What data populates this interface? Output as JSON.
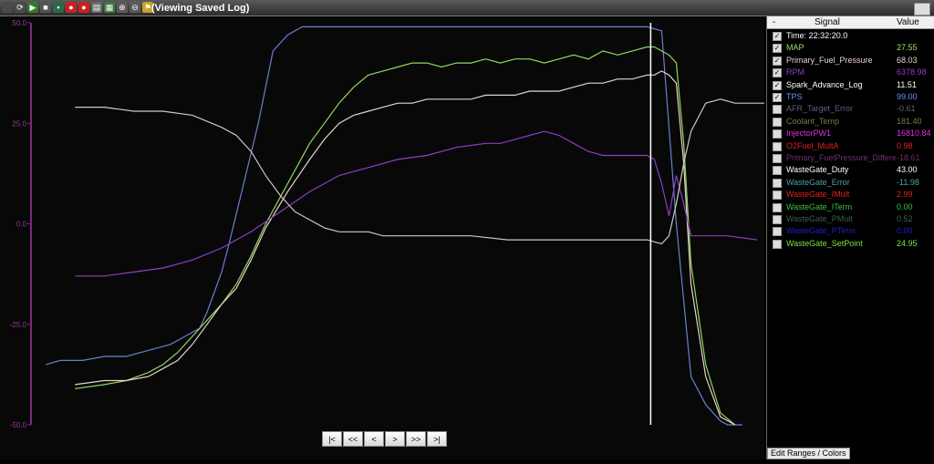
{
  "window": {
    "title": "(Viewing Saved Log)"
  },
  "toolbar": {
    "icons": [
      {
        "name": "open-icon",
        "color": "#4a4a4a",
        "glyph": ""
      },
      {
        "name": "refresh-icon",
        "color": "#4a4a4a",
        "glyph": "⟳"
      },
      {
        "name": "play-icon",
        "color": "#2d7d2d",
        "glyph": "▶"
      },
      {
        "name": "stop-icon",
        "color": "#555555",
        "glyph": "■"
      },
      {
        "name": "save-icon",
        "color": "#2a6a4a",
        "glyph": "▪"
      },
      {
        "name": "record-icon",
        "color": "#cc2020",
        "glyph": "●"
      },
      {
        "name": "record-stop-icon",
        "color": "#cc2020",
        "glyph": "●"
      },
      {
        "name": "print-icon",
        "color": "#6a6a6a",
        "glyph": "▤"
      },
      {
        "name": "export-icon",
        "color": "#3a7a3a",
        "glyph": "▦"
      },
      {
        "name": "zoom-in-icon",
        "color": "#5a5a5a",
        "glyph": "⊕"
      },
      {
        "name": "zoom-out-icon",
        "color": "#5a5a5a",
        "glyph": "⊖"
      },
      {
        "name": "marker-icon",
        "color": "#caa020",
        "glyph": "⚑"
      }
    ]
  },
  "panel": {
    "header": {
      "minus": "-",
      "signal": "Signal",
      "value": "Value"
    },
    "signals": [
      {
        "name": "Time: 22:32:20.0",
        "value": "",
        "color": "#ffffff",
        "checked": true
      },
      {
        "name": "MAP",
        "value": "27.55",
        "color": "#9ae06a",
        "checked": true
      },
      {
        "name": "Primary_Fuel_Pressure",
        "value": "68.03",
        "color": "#e8d4c8",
        "checked": true
      },
      {
        "name": "RPM",
        "value": "6378.98",
        "color": "#9040c0",
        "checked": true
      },
      {
        "name": "Spark_Advance_Log",
        "value": "11.51",
        "color": "#ffffff",
        "checked": true
      },
      {
        "name": "TPS",
        "value": "99.00",
        "color": "#7090ff",
        "checked": true
      },
      {
        "name": "AFR_Target_Error",
        "value": "-0.61",
        "color": "#606080",
        "checked": false
      },
      {
        "name": "Coolant_Temp",
        "value": "181.40",
        "color": "#807a40",
        "checked": false
      },
      {
        "name": "InjectorPW1",
        "value": "16810.84",
        "color": "#e030e0",
        "checked": false
      },
      {
        "name": "O2Fuel_MultA",
        "value": "0.98",
        "color": "#e02020",
        "checked": false
      },
      {
        "name": "Primary_FuelPressure_Difference",
        "value": "-18.61",
        "color": "#703070",
        "checked": false
      },
      {
        "name": "WasteGate_Duty",
        "value": "43.00",
        "color": "#ffffff",
        "checked": false
      },
      {
        "name": "WasteGate_Error",
        "value": "-11.98",
        "color": "#50a0a0",
        "checked": false
      },
      {
        "name": "WasteGate_IMult",
        "value": "2.99",
        "color": "#e02020",
        "checked": false
      },
      {
        "name": "WasteGate_ITerm",
        "value": "0.00",
        "color": "#40c040",
        "checked": false
      },
      {
        "name": "WasteGate_PMult",
        "value": "0.52",
        "color": "#406040",
        "checked": false
      },
      {
        "name": "WasteGate_PTerm",
        "value": "0.00",
        "color": "#2020c0",
        "checked": false
      },
      {
        "name": "WasteGate_SetPoint",
        "value": "24.95",
        "color": "#80e040",
        "checked": false
      }
    ],
    "edit_button": "Edit Ranges / Colors"
  },
  "navigation": {
    "buttons": [
      "|<",
      "<<",
      "<",
      ">",
      ">>",
      ">|"
    ]
  },
  "chart_data": {
    "type": "line",
    "ylim": [
      -50,
      50
    ],
    "yticks": [
      "50.0",
      "25.0",
      "0.0",
      "-25.0",
      "-50.0"
    ],
    "xlim": [
      0,
      100
    ],
    "cursor_x": 84.5,
    "series": [
      {
        "name": "TPS",
        "color": "#6a80d0",
        "x": [
          2,
          4,
          7,
          10,
          13,
          15,
          17,
          19,
          21,
          23,
          24,
          25,
          26,
          27,
          29,
          31,
          33,
          35,
          37,
          40,
          43,
          45,
          50,
          55,
          60,
          65,
          70,
          75,
          80,
          84,
          86,
          88,
          90,
          92,
          94,
          95,
          97
        ],
        "y": [
          -35,
          -34,
          -34,
          -33,
          -33,
          -32,
          -31,
          -30,
          -28,
          -26,
          -22,
          -17,
          -12,
          -5,
          10,
          25,
          43,
          47,
          49,
          49,
          49,
          49,
          49,
          49,
          49,
          49,
          49,
          49,
          49,
          49,
          48,
          0,
          -38,
          -45,
          -49,
          -50,
          -50
        ]
      },
      {
        "name": "MAP",
        "color": "#90d860",
        "x": [
          6,
          10,
          13,
          16,
          18,
          20,
          22,
          24,
          26,
          28,
          30,
          32,
          35,
          38,
          40,
          42,
          44,
          46,
          48,
          50,
          52,
          54,
          56,
          58,
          60,
          62,
          64,
          66,
          68,
          70,
          72,
          74,
          76,
          78,
          80,
          82,
          84,
          85,
          86,
          87,
          88,
          89,
          90,
          92,
          94,
          96
        ],
        "y": [
          -41,
          -40,
          -39,
          -37,
          -35,
          -32,
          -28,
          -24,
          -20,
          -15,
          -8,
          0,
          10,
          20,
          25,
          30,
          34,
          37,
          38,
          39,
          40,
          40,
          39,
          40,
          40,
          41,
          40,
          41,
          41,
          40,
          41,
          42,
          41,
          43,
          42,
          43,
          44,
          44,
          43,
          42,
          40,
          20,
          -10,
          -35,
          -47,
          -50
        ]
      },
      {
        "name": "Primary_Fuel_Pressure",
        "color": "#e8d4c8",
        "x": [
          6,
          10,
          13,
          16,
          18,
          20,
          22,
          24,
          26,
          28,
          30,
          32,
          35,
          38,
          40,
          42,
          44,
          46,
          48,
          50,
          52,
          54,
          56,
          58,
          60,
          62,
          64,
          66,
          68,
          70,
          72,
          74,
          76,
          78,
          80,
          82,
          84,
          85,
          86,
          87,
          88,
          89,
          90,
          92,
          94,
          96
        ],
        "y": [
          -40,
          -39,
          -39,
          -38,
          -36,
          -34,
          -30,
          -25,
          -20,
          -16,
          -9,
          -1,
          8,
          16,
          21,
          25,
          27,
          28,
          29,
          30,
          30,
          31,
          31,
          31,
          31,
          32,
          32,
          32,
          33,
          33,
          33,
          34,
          35,
          35,
          36,
          36,
          37,
          37,
          38,
          37,
          35,
          15,
          -15,
          -38,
          -48,
          -50
        ]
      },
      {
        "name": "RPM",
        "color": "#8a40c0",
        "x": [
          6,
          10,
          14,
          18,
          22,
          26,
          30,
          34,
          38,
          42,
          46,
          50,
          54,
          58,
          62,
          64,
          66,
          68,
          70,
          72,
          74,
          76,
          78,
          80,
          82,
          84,
          85,
          86,
          87,
          88,
          89,
          90,
          92,
          95,
          99
        ],
        "y": [
          -13,
          -13,
          -12,
          -11,
          -9,
          -6,
          -2,
          3,
          8,
          12,
          14,
          16,
          17,
          19,
          20,
          20,
          21,
          22,
          23,
          22,
          20,
          18,
          17,
          17,
          17,
          17,
          16,
          10,
          2,
          12,
          5,
          -3,
          -3,
          -3,
          -4
        ]
      },
      {
        "name": "Spark_Advance_Log",
        "color": "#c8c8c8",
        "x": [
          6,
          10,
          14,
          18,
          22,
          26,
          28,
          30,
          32,
          34,
          36,
          38,
          40,
          42,
          44,
          46,
          48,
          50,
          52,
          55,
          60,
          65,
          70,
          75,
          80,
          84,
          86,
          87,
          88,
          89,
          90,
          92,
          94,
          96,
          98,
          100
        ],
        "y": [
          29,
          29,
          28,
          28,
          27,
          24,
          22,
          18,
          12,
          7,
          3,
          1,
          -1,
          -2,
          -2,
          -2,
          -3,
          -3,
          -3,
          -3,
          -3,
          -4,
          -4,
          -4,
          -4,
          -4,
          -5,
          -3,
          5,
          15,
          23,
          30,
          31,
          30,
          30,
          30
        ]
      }
    ]
  }
}
